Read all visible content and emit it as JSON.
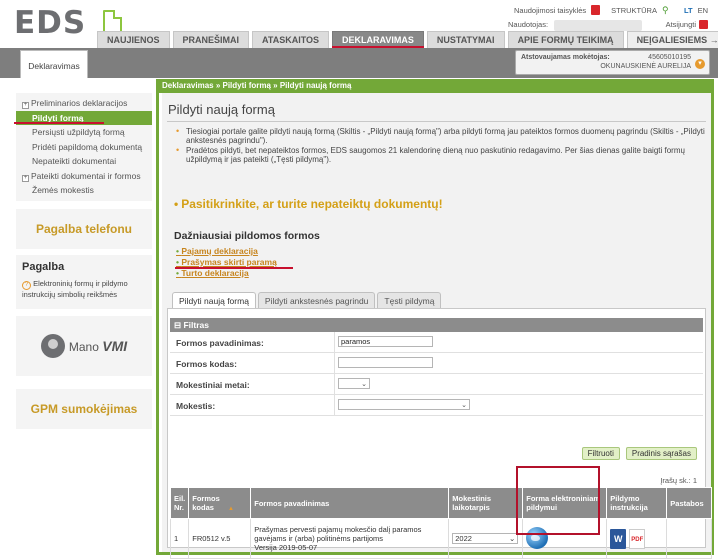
{
  "header": {
    "logo_text": "EDS",
    "rules_link": "Naudojimosi taisyklės",
    "structure_link": "STRUKTŪRA",
    "lang_lt": "LT",
    "lang_en": "EN",
    "user_label": "Naudotojas:",
    "logout_label": "Atsijungti"
  },
  "topnav": {
    "tabs": [
      {
        "label": "NAUJIENOS"
      },
      {
        "label": "PRANEŠIMAI"
      },
      {
        "label": "ATASKAITOS"
      },
      {
        "label": "DEKLARAVIMAS"
      },
      {
        "label": "NUSTATYMAI"
      },
      {
        "label": "APIE FORMŲ TEIKIMĄ"
      },
      {
        "label": "NEĮGALIESIEMS →"
      }
    ]
  },
  "subbar": {
    "active_tab": "Deklaravimas",
    "repr_label": "Atstovaujamas mokėtojas:",
    "repr_code": "45605010195",
    "repr_name": "OKUNAUSKIENĖ AURELIJA"
  },
  "sidebar": {
    "items": [
      {
        "label": "Preliminarios deklaracijos",
        "expandable": true
      },
      {
        "label": "Pildyti formą",
        "active": true
      },
      {
        "label": "Persiųsti užpildytą formą"
      },
      {
        "label": "Pridėti papildomą dokumentą"
      },
      {
        "label": "Nepateikti dokumentai"
      },
      {
        "label": "Pateikti dokumentai ir formos",
        "expandable": true
      },
      {
        "label": "Žemės mokestis"
      }
    ],
    "help_phone": "Pagalba telefonu",
    "help_title": "Pagalba",
    "help_link": "Elektroninių formų ir pildymo instrukcijų simbolių reikšmės",
    "mano_vmi_prefix": "Mano",
    "mano_vmi_suffix": "VMI",
    "gpm": "GPM sumokėjimas"
  },
  "main": {
    "breadcrumb": "Deklaravimas » Pildyti formą » Pildyti naują formą",
    "title": "Pildyti naują formą",
    "info": [
      "Tiesiogiai portale galite pildyti naują formą (Skiltis - „Pildyti naują formą\") arba pildyti formą jau pateiktos formos duomenų pagrindu (Skiltis - „Pildyti ankstesnės pagrindu\").",
      "Pradėtos pildyti, bet nepateiktos formos, EDS saugomos 21 kalendorinę dieną nuo paskutinio redagavimo. Per šias dienas galite baigti formų užpildymą ir jas pateikti („Tęsti pildymą\")."
    ],
    "warning": "Pasitikrinkite, ar turite nepateiktų dokumentų!",
    "frequent_title": "Dažniausiai pildomos formos",
    "frequent": [
      {
        "label": "Pajamų deklaracija"
      },
      {
        "label": "Prašymas skirti paramą"
      },
      {
        "label": "Turto deklaracija"
      }
    ],
    "tabs": [
      {
        "label": "Pildyti naują formą",
        "active": true
      },
      {
        "label": "Pildyti ankstesnės pagrindu"
      },
      {
        "label": "Tęsti pildymą"
      }
    ],
    "filter": {
      "header": "⊟ Filtras",
      "name_label": "Formos pavadinimas:",
      "name_value": "paramos",
      "code_label": "Formos kodas:",
      "code_value": "",
      "year_label": "Mokestiniai metai:",
      "year_value": "",
      "tax_label": "Mokestis:",
      "tax_value": "",
      "filter_button": "Filtruoti",
      "reset_button": "Pradinis sąrašas"
    },
    "records": "Įrašų sk.: 1",
    "table": {
      "headers": [
        "Eil. Nr.",
        "Formos kodas",
        "Formos pavadinimas",
        "Mokestinis laikotarpis",
        "Forma elektroniniam pildymui",
        "Pildymo instrukcija",
        "Pastabos"
      ],
      "rows": [
        {
          "nr": "1",
          "code": "FR0512 v.5",
          "name": "Prašymas pervesti pajamų mokesčio dalį paramos gavėjams ir (arba) politinėms partijoms",
          "version": "Versija 2019-05-07",
          "period": "2022",
          "notes": ""
        }
      ]
    }
  }
}
